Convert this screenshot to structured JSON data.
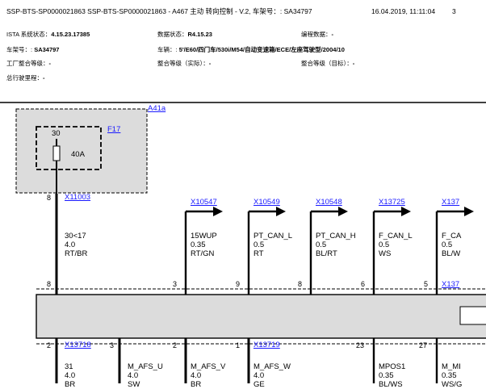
{
  "header": {
    "doc_ids": "SSP-BTS-SP0000021863 SSP-BTS-SP0000021863 - A467 主动 转向控制 - V.2, 车架号：: SA34797",
    "datetime": "16.04.2019, 11:11:04",
    "page": "3"
  },
  "meta": {
    "ista_label": "ISTA 系统状态：",
    "ista_value": "4.15.23.17385",
    "data_label": "数据状态：",
    "data_value": "R4.15.23",
    "prog_label": "编程数据：",
    "prog_value": "-",
    "vin_label": "车架号：:",
    "vin_value": "SA34797",
    "vehicle_label": "车辆：:",
    "vehicle_value": "5'/E60/四门车/530i/M54/自动变速箱/ECE/左座驾驶型/2004/10",
    "factory_label": "工厂整合等级：",
    "factory_value": "-",
    "int_actual_label": "整合等级（实际）：",
    "int_actual_value": "-",
    "int_target_label": "整合等级（目标）：",
    "int_target_value": "-",
    "part_label": "总行驶里程：",
    "part_value": "-"
  },
  "fuse_box": {
    "component": "A41a",
    "fuse_id": "F17",
    "fuse_pin": "30",
    "fuse_rating": "40A"
  },
  "top_wires": [
    {
      "pin": "8",
      "connector": "X11003",
      "signal": "30<17",
      "size": "4.0",
      "color": "RT/BR"
    },
    {
      "pin": "3",
      "connector": "X10547",
      "signal": "15WUP",
      "size": "0.35",
      "color": "RT/GN"
    },
    {
      "pin": "9",
      "connector": "X10549",
      "signal": "PT_CAN_L",
      "size": "0.5",
      "color": "RT"
    },
    {
      "pin": "8",
      "connector": "X10548",
      "signal": "PT_CAN_H",
      "size": "0.5",
      "color": "BL/RT"
    },
    {
      "pin": "6",
      "connector": "X13725",
      "signal": "F_CAN_L",
      "size": "0.5",
      "color": "WS"
    },
    {
      "pin": "5",
      "connector": "X137",
      "signal": "F_CA",
      "size": "0.5",
      "color": "BL/W"
    }
  ],
  "bottom_wires": [
    {
      "pin": "2",
      "connector": "X13718",
      "signal": "31",
      "size": "4.0",
      "color": "BR"
    },
    {
      "pin": "3",
      "connector": "",
      "signal": "M_AFS_U",
      "size": "4.0",
      "color": "SW"
    },
    {
      "pin": "2",
      "connector": "",
      "signal": "M_AFS_V",
      "size": "4.0",
      "color": "BR"
    },
    {
      "pin": "1",
      "connector": "X13719",
      "signal": "M_AFS_W",
      "size": "4.0",
      "color": "GE"
    },
    {
      "pin": "23",
      "connector": "",
      "signal": "MPOS1",
      "size": "0.35",
      "color": "BL/WS"
    },
    {
      "pin": "27",
      "connector": "",
      "signal": "M_MI",
      "size": "0.35",
      "color": "WS/G"
    }
  ],
  "right_connector": "X137"
}
